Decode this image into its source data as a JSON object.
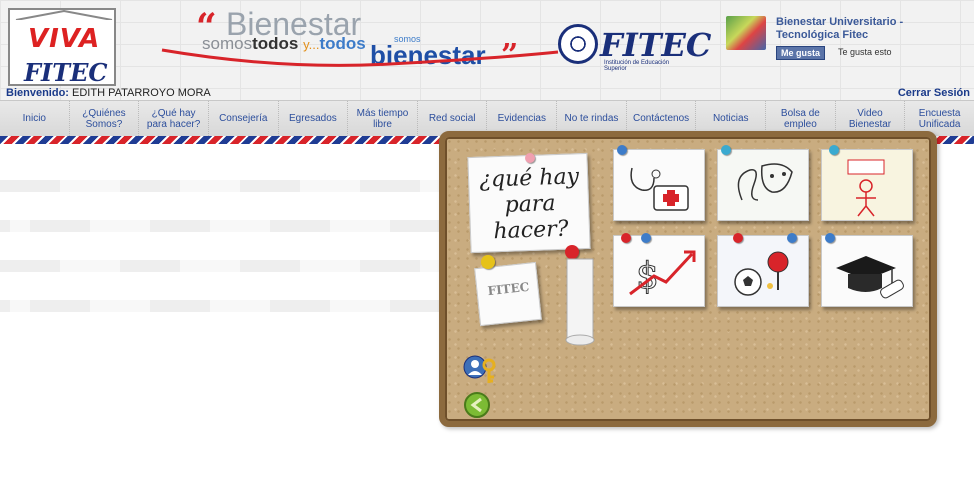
{
  "header": {
    "logo_viva": "VIVA",
    "logo_fitec": "FITEC",
    "slogan": {
      "quote_open": "“",
      "word1": "Bienestar",
      "line2_a": "somos",
      "line2_b": "todos",
      "line2_c": "y...",
      "line2_d": "todos",
      "somos_small": "somos",
      "word2": "bienestar",
      "quote_close": "”"
    },
    "institution_logo": "FITEC",
    "institution_sub": "Institución de Educación Superior",
    "facebook": {
      "page_name": "Bienestar Universitario - Tecnológica Fitec",
      "like_button": "Me gusta",
      "likes_text": "Te gusta esto"
    },
    "welcome_label": "Bienvenido:",
    "welcome_user": "EDITH PATARROYO MORA",
    "logout": "Cerrar Sesión"
  },
  "nav": {
    "items": [
      "Inicio",
      "¿Quiénes Somos?",
      "¿Qué hay para hacer?",
      "Consejería",
      "Egresados",
      "Más tiempo libre",
      "Red social",
      "Evidencias",
      "No te rindas",
      "Contáctenos",
      "Noticias",
      "Bolsa de empleo",
      "Video Bienestar",
      "Encuesta Unificada"
    ]
  },
  "board": {
    "main_note": "¿qué hay para hacer?",
    "small_logo": "FITEC",
    "notes": [
      "salud",
      "cultura",
      "deporte-logro",
      "financiero",
      "deportes",
      "académico"
    ]
  },
  "colors": {
    "brand_blue": "#1a2f7a",
    "brand_red": "#d8242a",
    "nav_text": "#2c4e9c",
    "cork": "#c9ac80",
    "frame": "#8c6a3e"
  }
}
